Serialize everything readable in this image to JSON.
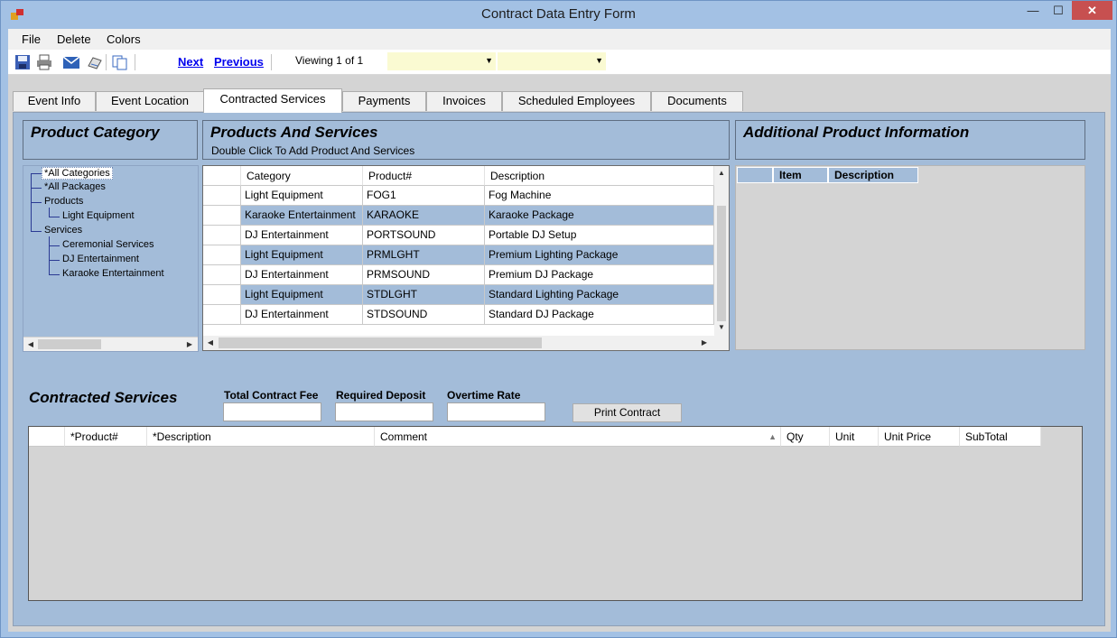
{
  "window": {
    "title": "Contract Data Entry Form"
  },
  "menu": [
    "File",
    "Delete",
    "Colors"
  ],
  "toolbar": {
    "next_label": "Next",
    "previous_label": "Previous",
    "viewing_text": "Viewing 1 of 1",
    "combo1_value": "",
    "combo2_value": ""
  },
  "tabs": [
    "Event Info",
    "Event Location",
    "Contracted Services",
    "Payments",
    "Invoices",
    "Scheduled Employees",
    "Documents"
  ],
  "active_tab": "Contracted Services",
  "product_category": {
    "title": "Product Category",
    "tree": [
      "*All Categories",
      "*All Packages",
      "Products",
      "Light Equipment",
      "Services",
      "Ceremonial Services",
      "DJ Entertainment",
      "Karaoke Entertainment"
    ]
  },
  "products": {
    "title": "Products And Services",
    "subtitle": "Double Click To Add Product And Services",
    "columns": [
      "Category",
      "Product#",
      "Description"
    ],
    "rows": [
      [
        "Light Equipment",
        "FOG1",
        "Fog Machine"
      ],
      [
        "Karaoke Entertainment",
        "KARAOKE",
        "Karaoke Package"
      ],
      [
        "DJ Entertainment",
        "PORTSOUND",
        "Portable DJ Setup"
      ],
      [
        "Light Equipment",
        "PRMLGHT",
        "Premium Lighting Package"
      ],
      [
        "DJ Entertainment",
        "PRMSOUND",
        "Premium DJ Package"
      ],
      [
        "Light Equipment",
        "STDLGHT",
        "Standard Lighting Package"
      ],
      [
        "DJ Entertainment",
        "STDSOUND",
        "Standard DJ Package"
      ]
    ]
  },
  "additional": {
    "title": "Additional Product Information",
    "columns": [
      "Item",
      "Description"
    ]
  },
  "contracted": {
    "title": "Contracted Services",
    "total_fee_label": "Total Contract Fee",
    "deposit_label": "Required Deposit",
    "overtime_label": "Overtime Rate",
    "total_fee_value": "",
    "deposit_value": "",
    "overtime_value": "",
    "print_label": "Print Contract",
    "columns": [
      "*Product#",
      "*Description",
      "Comment",
      "Qty",
      "Unit",
      "Unit Price",
      "SubTotal"
    ]
  },
  "icons": [
    "save-icon",
    "print-icon",
    "email-icon",
    "fax-icon",
    "copy-icon"
  ],
  "colors": {
    "accent": "#a3bcd9",
    "link": "#0000ee",
    "combo": "#fafad2"
  }
}
